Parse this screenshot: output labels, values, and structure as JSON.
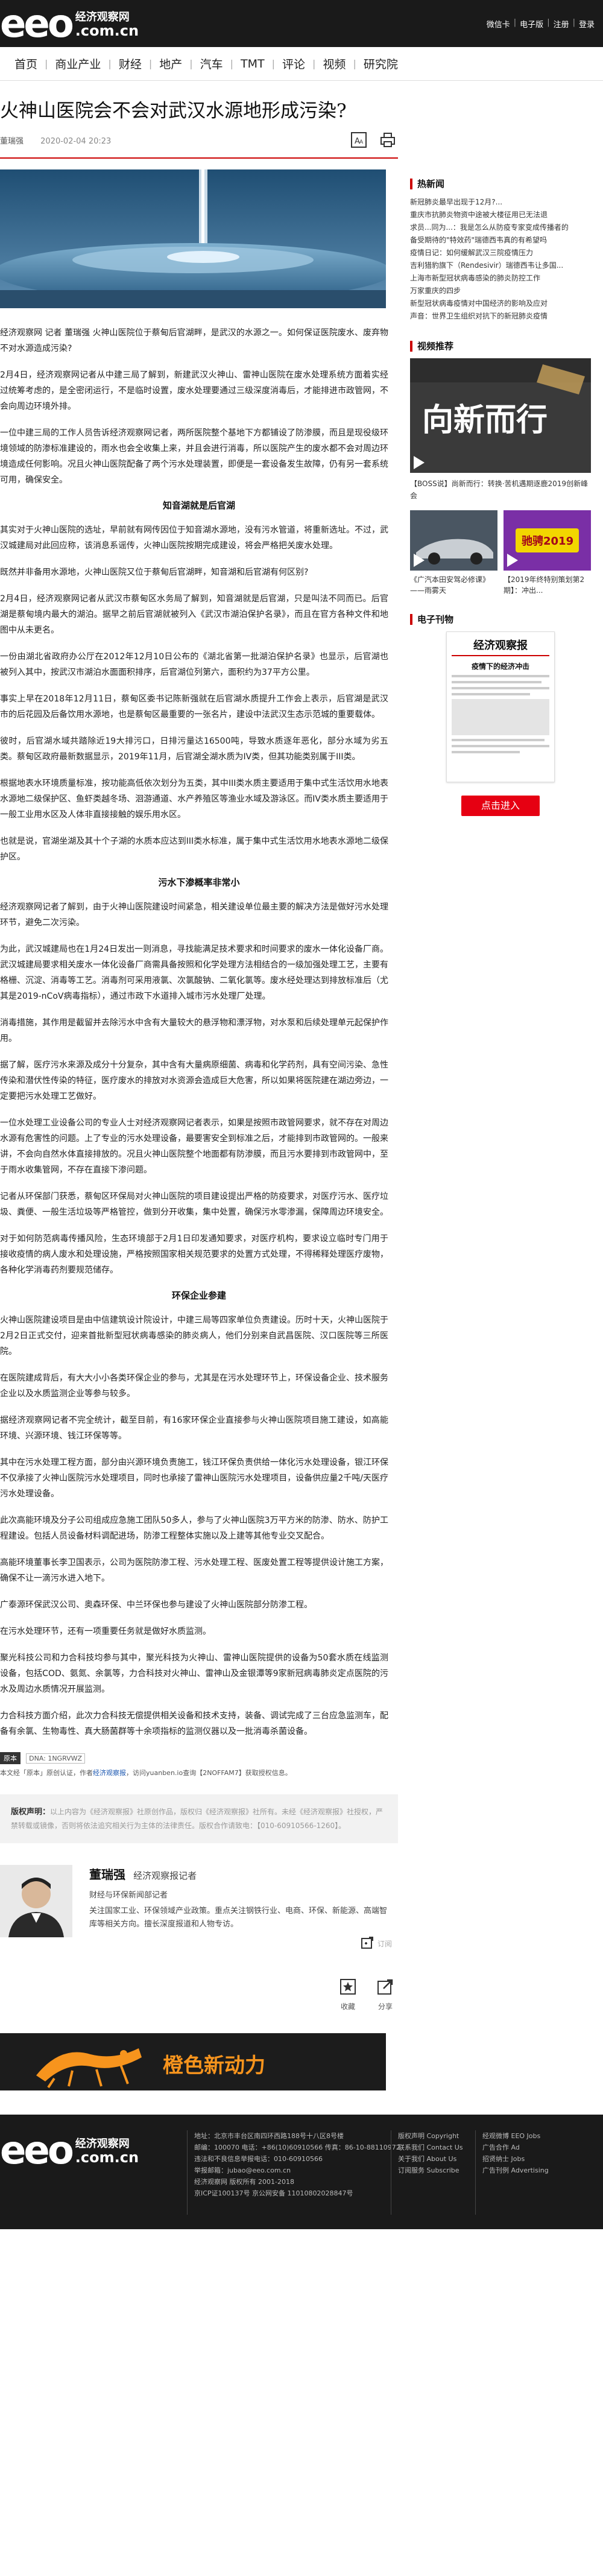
{
  "site": {
    "logo_main": "eeo",
    "logo_cn": "经济观察网",
    "logo_domain": ".com.cn"
  },
  "topbar": {
    "links": [
      "微信卡",
      "电子版",
      "注册",
      "登录"
    ]
  },
  "nav": {
    "items": [
      "首页",
      "商业产业",
      "财经",
      "地产",
      "汽车",
      "TMT",
      "评论",
      "视频",
      "研究院"
    ]
  },
  "article": {
    "title": "火神山医院会不会对武汉水源地形成污染?",
    "author": "董瑞强",
    "date": "2020-02-04 20:23",
    "paragraphs": [
      {
        "type": "p",
        "text": "经济观察网 记者 董瑞强  火神山医院位于蔡甸后官湖畔，是武汉的水源之一。如何保证医院废水、废弃物不对水源造成污染?"
      },
      {
        "type": "p",
        "text": "2月4日，经济观察网记者从中建三局了解到，新建武汉火神山、雷神山医院在废水处理系统方面着实经过统筹考虑的，是全密闭运行，不是临时设置，废水处理要通过三级深度消毒后，才能排进市政管网，不会向周边环境外排。"
      },
      {
        "type": "p",
        "text": "一位中建三局的工作人员告诉经济观察网记者，两所医院整个基地下方都铺设了防渗膜，而且是现役级环境领域的防渗标准建设的，雨水也会全收集上来，并且会进行消毒，所以医院产生的废水都不会对周边环境造成任何影响。况且火神山医院配备了两个污水处理装置，即便是一套设备发生故障，仍有另一套系统可用，确保安全。"
      },
      {
        "type": "h3",
        "text": "知音湖就是后官湖"
      },
      {
        "type": "p",
        "text": "其实对于火神山医院的选址，早前就有网传因位于知音湖水源地，没有污水管道，将重新选址。不过，武汉城建局对此回应称，该消息系谣传，火神山医院按期完成建设，将会严格把关废水处理。"
      },
      {
        "type": "p",
        "text": "既然并非备用水源地，火神山医院又位于蔡甸后官湖畔，知音湖和后官湖有何区别?"
      },
      {
        "type": "p",
        "text": "2月4日，经济观察网记者从武汉市蔡甸区水务局了解到，知音湖就是后官湖，只是叫法不同而已。后官湖是蔡甸境内最大的湖泊。据早之前后官湖就被列入《武汉市湖泊保护名录》，而且在官方各种文件和地图中从未更名。"
      },
      {
        "type": "p",
        "text": "一份由湖北省政府办公厅在2012年12月10日公布的《湖北省第一批湖泊保护名录》也显示，后官湖也被列入其中，按武汉市湖泊水面面积排序，后官湖位列第六，面积约为37平方公里。"
      },
      {
        "type": "p",
        "text": "事实上早在2018年12月11日，蔡甸区委书记陈新强就在后官湖水质提升工作会上表示，后官湖是武汉市的后花园及后备饮用水源地，也是蔡甸区最重要的一张名片，建设中法武汉生态示范城的重要载体。"
      },
      {
        "type": "p",
        "text": "彼时，后官湖水域共踏除近19大排污口，日排污量达16500吨，导致水质逐年恶化，部分水域为劣五类。蔡甸区政府最新数据显示，2019年11月，后官湖全湖水质为IV类，但其功能类别属于III类。"
      },
      {
        "type": "p",
        "text": "根据地表水环境质量标准，按功能高低依次划分为五类，其中III类水质主要适用于集中式生活饮用水地表水源地二级保护区、鱼虾类越冬场、洄游通道、水产养殖区等渔业水域及游泳区。而IV类水质主要适用于一般工业用水区及人体非直接接触的娱乐用水区。"
      },
      {
        "type": "p",
        "text": "也就是说，官湖坐湖及其十个子湖的水质本应达到III类水标准，属于集中式生活饮用水地表水源地二级保护区。"
      },
      {
        "type": "h3",
        "text": "污水下渗概率非常小"
      },
      {
        "type": "p",
        "text": "经济观察网记者了解到，由于火神山医院建设时间紧急，相关建设单位最主要的解决方法是做好污水处理环节，避免二次污染。"
      },
      {
        "type": "p",
        "text": "为此，武汉城建局也在1月24日发出一则消息，寻找能满足技术要求和时间要求的废水一体化设备厂商。武汉城建局要求相关废水一体化设备厂商需具备按照和化学处理方法相结合的一级加强处理工艺，主要有格栅、沉淀、消毒等工艺。消毒剂可采用液氯、次氯酸钠、二氧化氯等。废水经处理达到排放标准后（尤其是2019-nCoV病毒指标），通过市政下水道排入城市污水处理厂处理。"
      },
      {
        "type": "p",
        "text": "消毒措施，其作用是截留并去除污水中含有大量较大的悬浮物和漂浮物，对水泵和后续处理单元起保护作用。"
      },
      {
        "type": "p",
        "text": "据了解，医疗污水来源及成分十分复杂，其中含有大量病原细菌、病毒和化学药剂，具有空间污染、急性传染和潜伏性传染的特征，医疗废水的排放对水资源会造成巨大危害，所以如果将医院建在湖边旁边，一定要把污水处理工艺做好。"
      },
      {
        "type": "p",
        "text": "一位水处理工业设备公司的专业人士对经济观察网记者表示，如果是按照市政管网要求，就不存在对周边水源有危害性的问题。上了专业的污水处理设备，最要害安全到标准之后，才能排到市政管网的。一般来讲，不会向自然水体直接排放的。况且火神山医院整个地面都有防渗膜，而且污水要排到市政管网中，至于雨水收集管网，不存在直接下渗问题。"
      },
      {
        "type": "p",
        "text": "记者从环保部门获悉，蔡甸区环保局对火神山医院的项目建设提出严格的防疫要求，对医疗污水、医疗垃圾、粪便、一般生活垃圾等严格管控，做到分开收集，集中处置，确保污水零渗漏，保障周边环境安全。"
      },
      {
        "type": "p",
        "text": "对于如何防范病毒传播风险，生态环境部于2月1日印发通知要求，对医疗机构，要求设立临时专门用于接收疫情的病人废水和处理设施，严格按照国家相关规范要求的处置方式处理，不得稀释处理医疗废物，各种化学消毒药剂要规范储存。"
      },
      {
        "type": "h3",
        "text": "环保企业参建"
      },
      {
        "type": "p",
        "text": "火神山医院建设项目是由中信建筑设计院设计，中建三局等四家单位负责建设。历时十天，火神山医院于2月2日正式交付，迎来首批新型冠状病毒感染的肺炎病人，他们分别来自武昌医院、汉口医院等三所医院。"
      },
      {
        "type": "p",
        "text": "在医院建成背后，有大大小小各类环保企业的参与，尤其是在污水处理环节上，环保设备企业、技术服务企业以及水质监测企业等参与较多。"
      },
      {
        "type": "p",
        "text": "据经济观察网记者不完全统计，截至目前，有16家环保企业直接参与火神山医院项目施工建设，如高能环境、兴源环境、钱江环保等等。"
      },
      {
        "type": "p",
        "text": "其中在污水处理工程方面，部分由兴源环境负责施工，钱江环保负责供给一体化污水处理设备，银江环保不仅承接了火神山医院污水处理项目，同时也承接了雷神山医院污水处理项目，设备供应量2千吨/天医疗污水处理设备。"
      },
      {
        "type": "p",
        "text": "此次高能环境及分子公司组成应急施工团队50多人，参与了火神山医院3万平方米的防渗、防水、防护工程建设。包括人员设备材料调配进场，防渗工程整体实施以及上建等其他专业交叉配合。"
      },
      {
        "type": "p",
        "text": "高能环境董事长李卫国表示，公司为医院防渗工程、污水处理工程、医废处置工程等提供设计施工方案，确保不让一滴污水进入地下。"
      },
      {
        "type": "p",
        "text": "广泰源环保武汉公司、奥森环保、中兰环保也参与建设了火神山医院部分防渗工程。"
      },
      {
        "type": "p",
        "text": "在污水处理环节，还有一项重要任务就是做好水质监测。"
      },
      {
        "type": "p",
        "text": "聚光科技公司和力合科技均参与其中，聚光科技为火神山、雷神山医院提供的设备为50套水质在线监测设备，包括COD、氨氮、余氯等，力合科技对火神山、雷神山及金银潭等9家新冠病毒肺炎定点医院的污水及周边水质情况开展监测。"
      },
      {
        "type": "p",
        "text": "力合科技方面介绍，此次力合科技无偿提供相关设备和技术支持，装备、调试完成了三台应急监测车，配备有余氯、生物毒性、真大肠菌群等十余项指标的监测仪器以及一批消毒杀菌设备。"
      }
    ]
  },
  "cbn": {
    "badge": "原本",
    "badge2": "DNA: 1NGRVWZ",
    "line_prefix": "本文经「原本」原创认证，作者",
    "line_author": "经济观察报",
    "line_mid": "，访问yuanben.io查询【",
    "line_code": "2NOFFAM7",
    "line_suffix": "】获取授权信息。"
  },
  "copyright": {
    "title": "版权声明：",
    "text": "以上内容为《经济观察报》社原创作品，版权归《经济观察报》社所有。未经《经济观察报》社授权，严禁转载或镜像，否则将依法追究相关行为主体的法律责任。版权合作请致电：【010-60910566-1260】。"
  },
  "author": {
    "name": "董瑞强",
    "role": "经济观察报记者",
    "desk": "财经与环保新闻部记者",
    "bio": "关注国家工业、环保领域产业政策。重点关注钢铁行业、电商、环保、新能源、高端智库等相关方向。擅长深度报道和人物专访。",
    "subscribe": "订阅"
  },
  "actions": {
    "collect": "收藏",
    "share": "分享"
  },
  "banner": {
    "text": "橙色新动力"
  },
  "sidebar": {
    "hot_title": "热新闻",
    "hot_news": [
      "新冠肺炎最早出现于12月?...",
      "重庆市抗肺炎物资中途被大楼征用已无法退",
      "求员...同为...：我是怎么从防疫专家变成传播者的",
      "备受期待的\"特效药\"瑞德西韦真的有希望吗",
      "疫情日记：如何缓解武汉三院疫情压力",
      "吉利猎豹旗下（Rendesivir）瑞德西韦让多国...",
      "上海市新型冠状病毒感染的肺炎防控工作",
      "万家重庆的四步",
      "新型冠状病毒疫情对中国经济的影响及应对",
      "声音：世界卫生组织对抗下的新冠肺炎疫情"
    ],
    "video_title": "视频推荐",
    "video_main_overlay": "向新而行",
    "video_main_caption": "【BOSS说】尚新而行：转换·苦机遇期逐鹿2019创新峰会",
    "video_small": [
      {
        "caption": "《广汽本田安驾必修课》——雨雾天"
      },
      {
        "caption": "【2019年终特别策划第2期】：冲出...",
        "overlay": "驰骋2019"
      }
    ],
    "paper_title": "电子刊物",
    "paper_mast": "经济观察报",
    "paper_head": "疫情下的经济冲击",
    "enter_label": "点击进入"
  },
  "footer": {
    "mid_lines": [
      "地址：北京市丰台区南四环西路188号十八区8号楼",
      "邮编：100070  电话：+86(10)60910566  传真：86-10-88110972",
      "违法和不良信息举报电话：010-60910566",
      "举报邮箱：jubao@eeo.com.cn",
      "经济观察网 版权所有 2001-2018",
      "京ICP证100137号  京公网安备 11010802028847号"
    ],
    "col1": [
      "版权声明 Copyright",
      "联系我们 Contact Us",
      "关于我们 About Us",
      "订阅服务 Subscribe"
    ],
    "col2": [
      "经观微博 EEO Jobs",
      "广告合作 Ad",
      "招贤纳士 Jobs",
      "广告刊例 Advertising"
    ]
  }
}
